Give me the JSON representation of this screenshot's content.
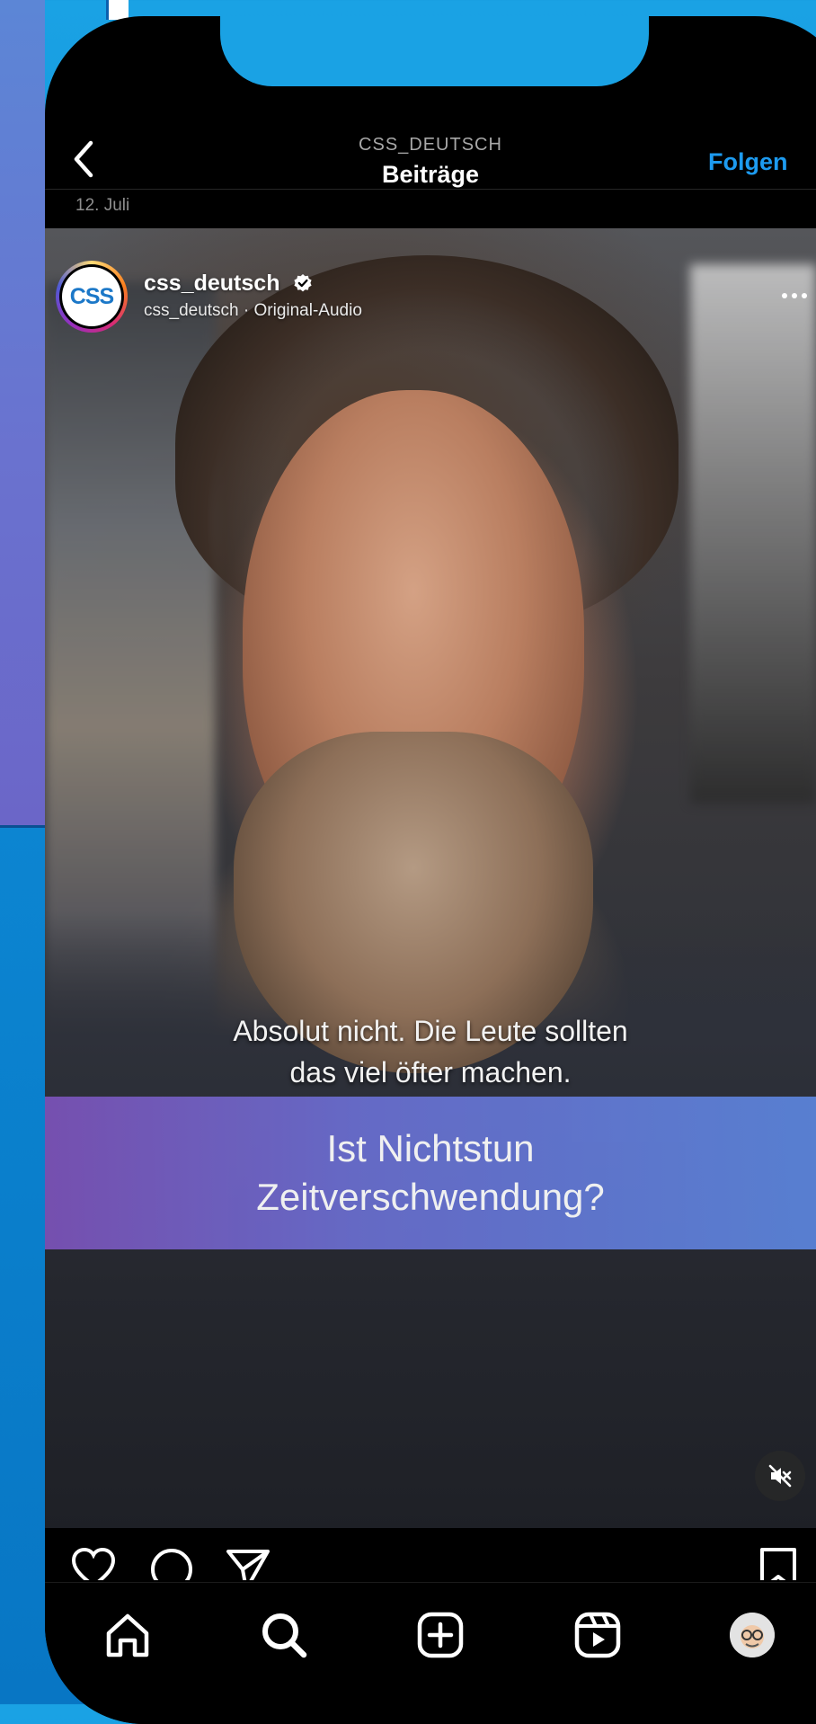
{
  "header": {
    "account_handle": "CSS_DEUTSCH",
    "title": "Beiträge",
    "follow_label": "Folgen",
    "date": "12. Juli"
  },
  "post": {
    "avatar_text": "CSS",
    "username": "css_deutsch",
    "audio_line": "css_deutsch · Original-Audio",
    "subtitle_line1": "Absolut nicht. Die Leute sollten",
    "subtitle_line2": "das viel öfter machen.",
    "banner_line1": "Ist Nichtstun",
    "banner_line2": "Zeitverschwendung?",
    "muted": true
  },
  "icons": {
    "back": "chevron-left-icon",
    "verified": "verified-badge-icon",
    "more": "more-horizontal-icon",
    "mute": "volume-muted-icon",
    "like": "heart-icon",
    "comment": "comment-icon",
    "share": "send-icon",
    "save": "bookmark-icon",
    "nav": [
      "home-icon",
      "search-icon",
      "create-icon",
      "reels-icon",
      "profile-avatar"
    ]
  },
  "colors": {
    "accent": "#1d9bf0",
    "banner_start": "#7b52b8",
    "banner_end": "#5b85dc",
    "background": "#000000"
  }
}
